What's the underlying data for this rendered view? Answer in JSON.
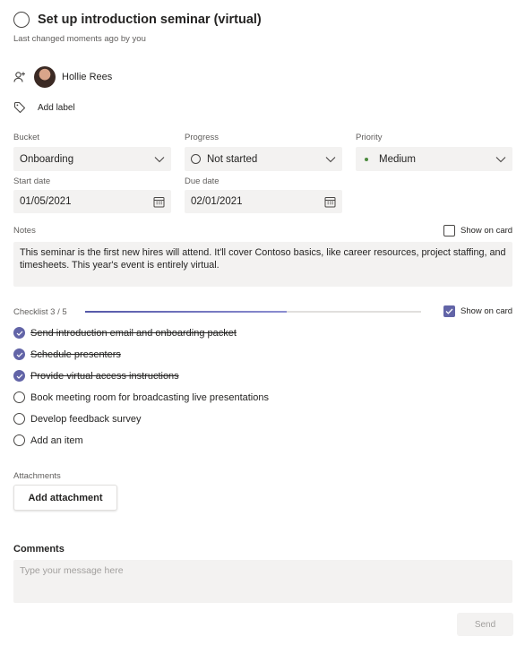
{
  "task": {
    "title": "Set up introduction seminar (virtual)",
    "last_changed": "Last changed moments ago by you"
  },
  "assignee": {
    "name": "Hollie Rees",
    "icon": "assign-person-icon"
  },
  "label": {
    "add_text": "Add label",
    "icon": "tag-icon"
  },
  "fields": {
    "bucket": {
      "label": "Bucket",
      "value": "Onboarding"
    },
    "progress": {
      "label": "Progress",
      "value": "Not started"
    },
    "priority": {
      "label": "Priority",
      "value": "Medium",
      "dot_color": "#4c8b3f"
    },
    "start_date": {
      "label": "Start date",
      "value": "01/05/2021"
    },
    "due_date": {
      "label": "Due date",
      "value": "02/01/2021"
    }
  },
  "notes": {
    "label": "Notes",
    "show_on_card": "Show on card",
    "show_on_card_checked": false,
    "text": "This seminar is the first new hires will attend. It'll cover Contoso basics, like career resources, project staffing, and timesheets. This year's event is entirely virtual."
  },
  "checklist": {
    "header": "Checklist 3 / 5",
    "progress_fraction": 0.6,
    "show_on_card": "Show on card",
    "show_on_card_checked": true,
    "items": [
      {
        "text": "Send introduction email and onboarding packet",
        "done": true
      },
      {
        "text": "Schedule presenters",
        "done": true
      },
      {
        "text": "Provide virtual access instructions",
        "done": true
      },
      {
        "text": "Book meeting room for broadcasting live presentations",
        "done": false
      },
      {
        "text": "Develop feedback survey",
        "done": false
      }
    ],
    "add_item": "Add an item"
  },
  "attachments": {
    "label": "Attachments",
    "button": "Add attachment"
  },
  "comments": {
    "label": "Comments",
    "placeholder": "Type your message here",
    "send": "Send"
  },
  "colors": {
    "accent": "#6264a7",
    "field_bg": "#f3f2f1",
    "muted_text": "#605e5c"
  }
}
